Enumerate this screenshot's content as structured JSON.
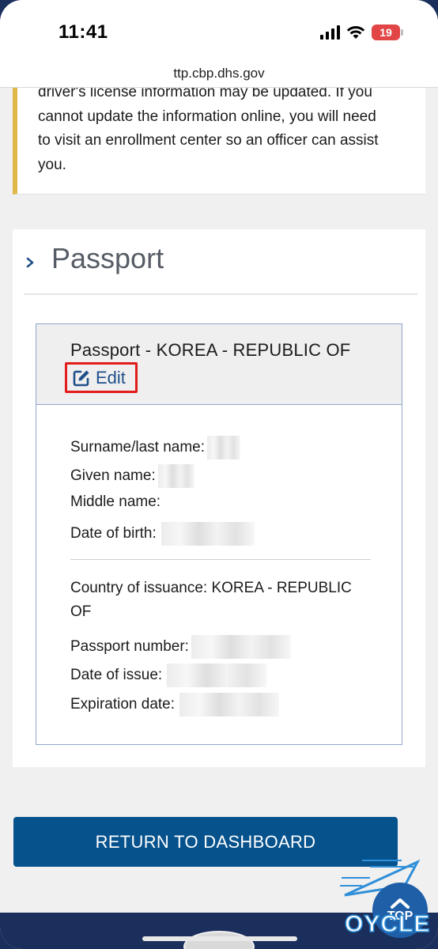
{
  "status_bar": {
    "time": "11:41",
    "battery": "19"
  },
  "browser": {
    "url": "ttp.cbp.dhs.gov"
  },
  "notice": {
    "lines": [
      "driver's license information may be updated. If you",
      "cannot update the information online, you will need",
      "to visit an enrollment center so an officer can assist",
      "you."
    ]
  },
  "section": {
    "title": "Passport"
  },
  "passport_card": {
    "title": "Passport - KOREA - REPUBLIC OF",
    "edit_label": "Edit",
    "fields": {
      "surname_label": "Surname/last name:",
      "given_label": "Given name:",
      "middle_label": "Middle name:",
      "dob_label": "Date of birth:",
      "country_label": "Country of issuance:",
      "country_value": "KOREA - REPUBLIC OF",
      "passport_number_label": "Passport number:",
      "issue_date_label": "Date of issue:",
      "expiration_label": "Expiration date:"
    }
  },
  "actions": {
    "return_label": "RETURN TO DASHBOARD",
    "top_label": "TOP"
  },
  "watermark": {
    "text": "OYCLE"
  },
  "colors": {
    "primary": "#06528c",
    "accent_border": "#e0b84a",
    "highlight_red": "#e21b1b",
    "footer": "#1a2f5c"
  },
  "icons": [
    "chevron-right-icon",
    "edit-icon",
    "chevron-up-icon",
    "signal-icon",
    "wifi-icon",
    "battery-icon"
  ]
}
